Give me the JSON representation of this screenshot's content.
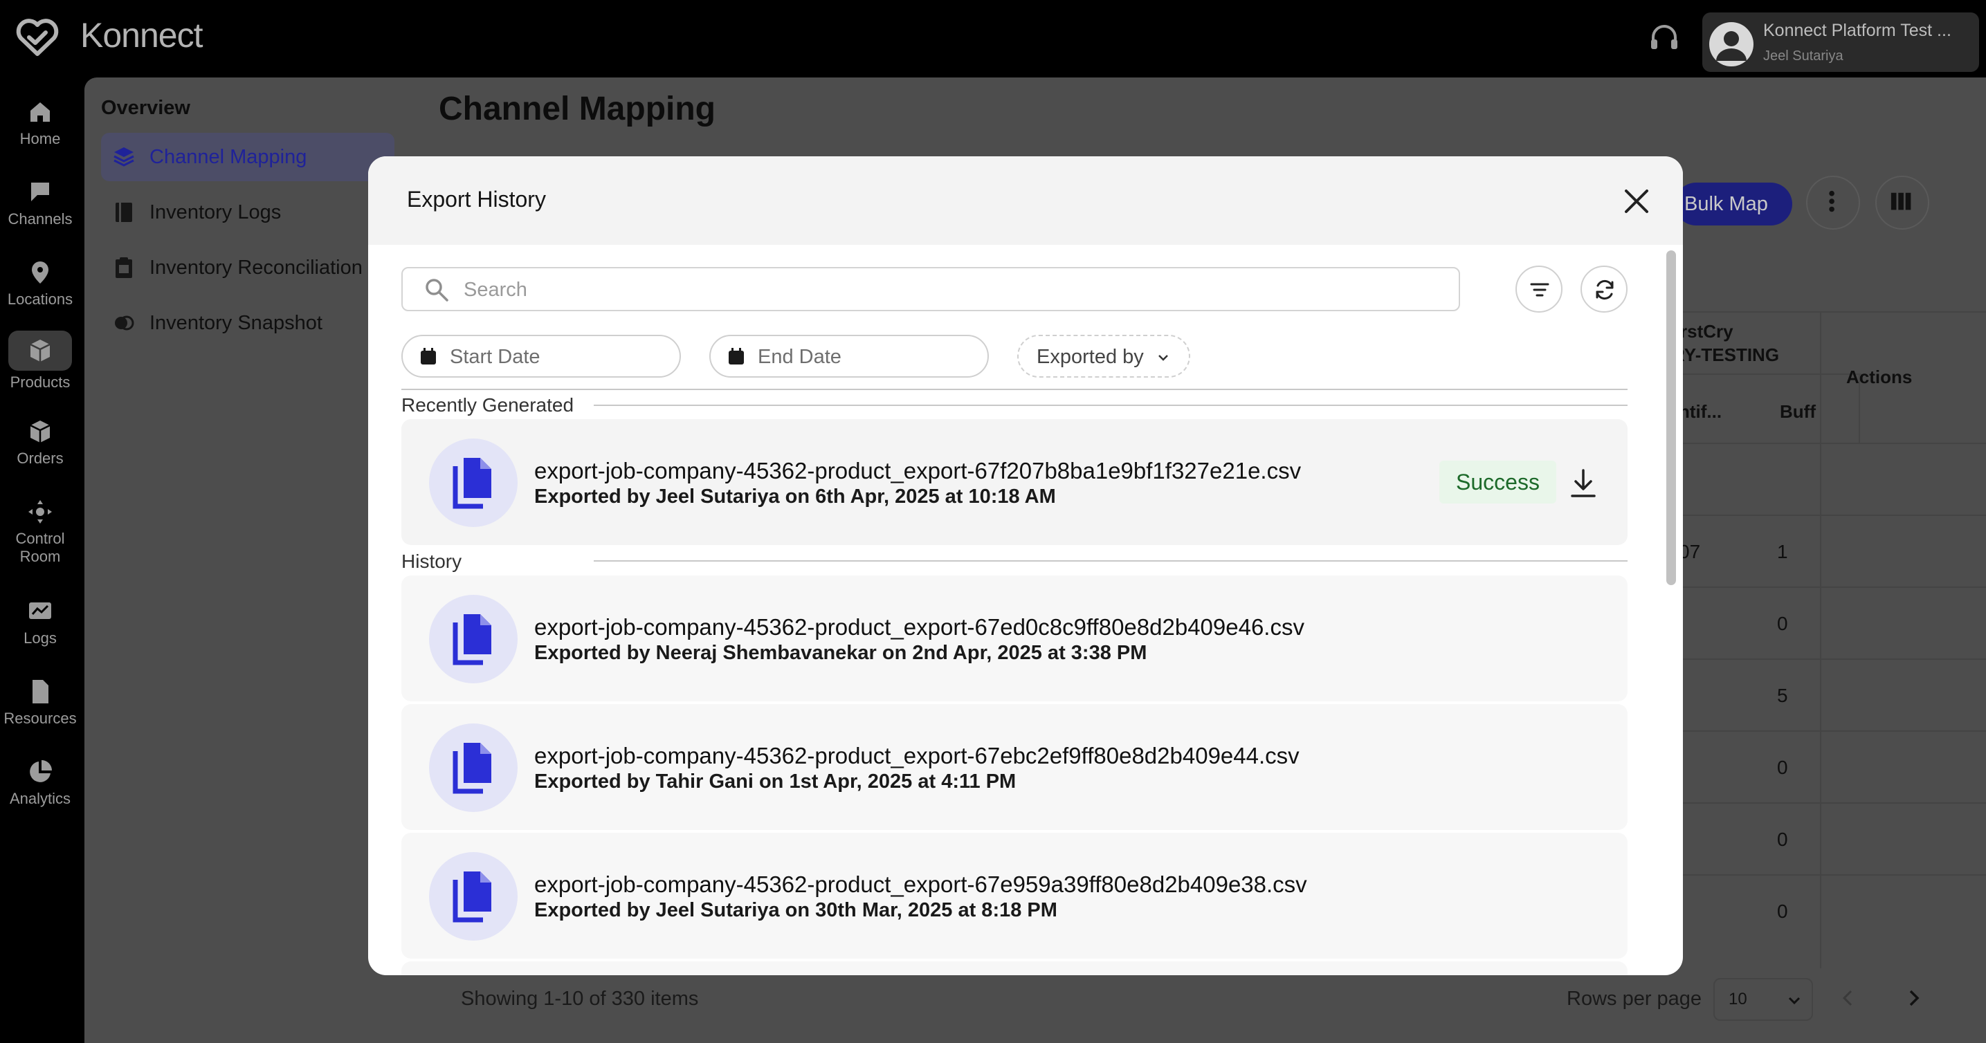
{
  "app": {
    "name": "Konnect"
  },
  "account": {
    "name": "Konnect Platform Test ...",
    "user": "Jeel Sutariya"
  },
  "leftnav": {
    "items": [
      {
        "label": "Home",
        "icon": "home-icon"
      },
      {
        "label": "Channels",
        "icon": "flag-icon"
      },
      {
        "label": "Locations",
        "icon": "location-pin-icon"
      },
      {
        "label": "Products",
        "icon": "cube-icon",
        "active": true
      },
      {
        "label": "Orders",
        "icon": "box-icon"
      },
      {
        "label": "Control",
        "label2": "Room",
        "icon": "control-room-icon"
      },
      {
        "label": "Logs",
        "icon": "logs-icon"
      },
      {
        "label": "Resources",
        "icon": "document-icon"
      },
      {
        "label": "Analytics",
        "icon": "pie-chart-icon"
      }
    ]
  },
  "subnav": {
    "title": "Overview",
    "items": [
      {
        "label": "Channel Mapping",
        "active": true
      },
      {
        "label": "Inventory Logs"
      },
      {
        "label": "Inventory Reconciliation"
      },
      {
        "label": "Inventory Snapshot"
      }
    ]
  },
  "page": {
    "title": "Channel Mapping",
    "bulk_map_label": "Bulk Map",
    "table": {
      "header_line1": "rstCry",
      "header_line2": "RY-TESTING",
      "sub_header_a": "ntif...",
      "sub_header_b": "Buff",
      "actions_label": "Actions",
      "row_partial": "07",
      "buffer_values": [
        "1",
        "0",
        "5",
        "0",
        "0",
        "0"
      ]
    },
    "footer": {
      "showing": "Showing 1-10 of 330 items",
      "rows_per_page_label": "Rows per page",
      "rows_per_page_value": "10"
    }
  },
  "modal": {
    "title": "Export History",
    "search_placeholder": "Search",
    "start_date_label": "Start Date",
    "end_date_label": "End Date",
    "exported_by_label": "Exported by",
    "recent_section_label": "Recently Generated",
    "history_section_label": "History",
    "recent": {
      "file": "export-job-company-45362-product_export-67f207b8ba1e9bf1f327e21e.csv",
      "meta": "Exported by Jeel Sutariya on 6th Apr, 2025 at 10:18 AM",
      "status": "Success"
    },
    "history": [
      {
        "file": "export-job-company-45362-product_export-67ed0c8c9ff80e8d2b409e46.csv",
        "meta": "Exported by Neeraj Shembavanekar on 2nd Apr, 2025 at 3:38 PM"
      },
      {
        "file": "export-job-company-45362-product_export-67ebc2ef9ff80e8d2b409e44.csv",
        "meta": "Exported by Tahir Gani on 1st Apr, 2025 at 4:11 PM"
      },
      {
        "file": "export-job-company-45362-product_export-67e959a39ff80e8d2b409e38.csv",
        "meta": "Exported by Jeel Sutariya on 30th Mar, 2025 at 8:18 PM"
      }
    ]
  },
  "colors": {
    "accent": "#2b2fd6",
    "file_icon_bg": "#e3e4f7",
    "success_bg": "#e9f6ea",
    "success_text": "#1d6a2a"
  }
}
